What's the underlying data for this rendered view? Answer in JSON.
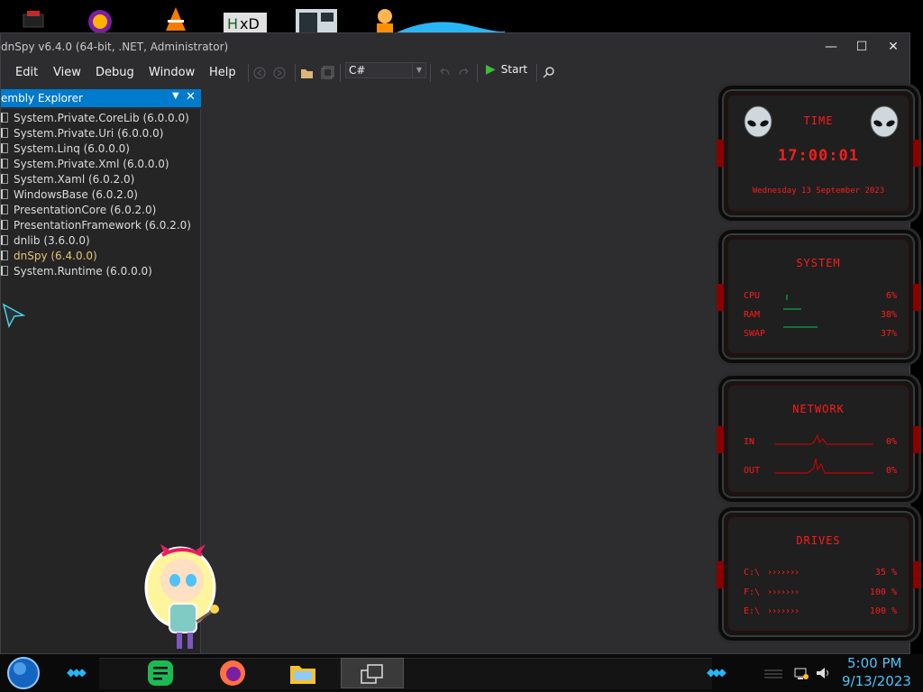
{
  "window": {
    "title": "dnSpy v6.4.0 (64-bit, .NET, Administrator)",
    "minimize_glyph": "—",
    "maximize_glyph": "☐",
    "close_glyph": "✕"
  },
  "menu": {
    "edit": "Edit",
    "view": "View",
    "debug": "Debug",
    "window": "Window",
    "help": "Help"
  },
  "toolbar": {
    "language": "C#",
    "start_label": "Start"
  },
  "assembly_explorer": {
    "title": "embly Explorer",
    "items": [
      {
        "name": "System.Private.CoreLib (6.0.0.0)"
      },
      {
        "name": "System.Private.Uri (6.0.0.0)"
      },
      {
        "name": "System.Linq (6.0.0.0)"
      },
      {
        "name": "System.Private.Xml (6.0.0.0)"
      },
      {
        "name": "System.Xaml (6.0.2.0)"
      },
      {
        "name": "WindowsBase (6.0.2.0)"
      },
      {
        "name": "PresentationCore (6.0.2.0)"
      },
      {
        "name": "PresentationFramework (6.0.2.0)"
      },
      {
        "name": "dnlib (3.6.0.0)"
      },
      {
        "name": "dnSpy (6.4.0.0)"
      },
      {
        "name": "System.Runtime (6.0.0.0)"
      }
    ]
  },
  "gadgets": {
    "time": {
      "title": "TIME",
      "clock": "17:00:01",
      "date": "Wednesday 13 September 2023"
    },
    "system": {
      "title": "SYSTEM",
      "cpu_label": "CPU",
      "cpu_value": "6%",
      "ram_label": "RAM",
      "ram_value": "38%",
      "swap_label": "SWAP",
      "swap_value": "37%"
    },
    "network": {
      "title": "NETWORK",
      "in_label": "IN",
      "in_value": "0%",
      "out_label": "OUT",
      "out_value": "0%"
    },
    "drives": {
      "title": "DRIVES",
      "c_label": "C:\\",
      "c_value": "35 %",
      "f_label": "F:\\",
      "f_value": "100 %",
      "e_label": "E:\\",
      "e_value": "100 %"
    }
  },
  "taskbar": {
    "time": "5:00 PM",
    "date": "9/13/2023"
  },
  "colors": {
    "accent": "#007acc",
    "gadget_red": "#ff1a1a",
    "clock_blue": "#4fc3f7"
  }
}
